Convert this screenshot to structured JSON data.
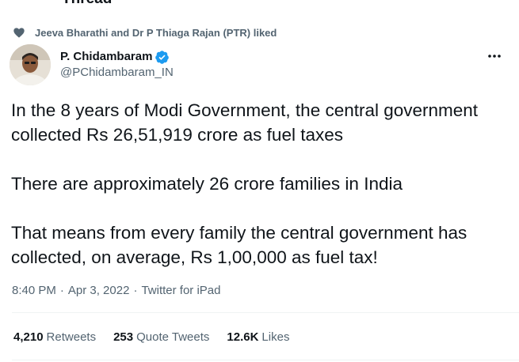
{
  "header": {
    "title_partial": "Thread"
  },
  "social_context": {
    "icon": "heart-icon",
    "text": "Jeeva Bharathi and Dr P Thiaga Rajan (PTR) liked"
  },
  "author": {
    "display_name": "P. Chidambaram",
    "handle": "@PChidambaram_IN",
    "verified": true,
    "verified_color": "#1d9bf0"
  },
  "tweet": {
    "paragraphs": [
      "In the 8 years of Modi Government, the central government collected Rs 26,51,919 crore as fuel taxes",
      "There are approximately 26 crore families in India",
      "That means from every family the central government has collected, on average, Rs 1,00,000 as fuel tax!"
    ]
  },
  "meta": {
    "time": "8:40 PM",
    "separator": "·",
    "date": "Apr 3, 2022",
    "source": "Twitter for iPad"
  },
  "stats": {
    "retweets": {
      "count": "4,210",
      "label": "Retweets"
    },
    "quotes": {
      "count": "253",
      "label": "Quote Tweets"
    },
    "likes": {
      "count": "12.6K",
      "label": "Likes"
    }
  },
  "colors": {
    "text_primary": "#0f1419",
    "text_secondary": "#536471",
    "divider": "#eff3f4"
  }
}
